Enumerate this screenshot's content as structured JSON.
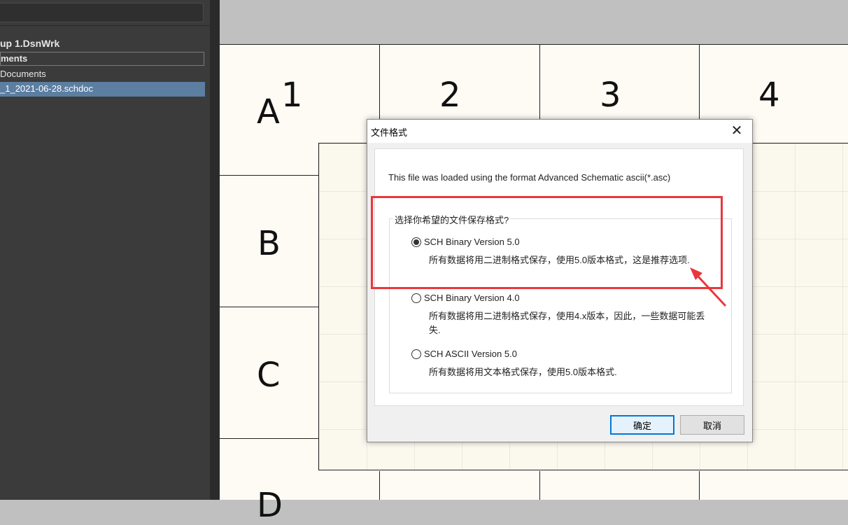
{
  "project_panel": {
    "workspace": "up 1.DsnWrk",
    "section": "ments",
    "documents_folder": "Documents",
    "selected_file": "_1_2021-06-28.schdoc"
  },
  "sheet": {
    "columns": [
      "1",
      "2",
      "3",
      "4"
    ],
    "rows": [
      "A",
      "B",
      "C",
      "D"
    ]
  },
  "dialog": {
    "title": "文件格式",
    "close_glyph": "✕",
    "message": "This file was loaded using the format Advanced Schematic ascii(*.asc)",
    "group_label": "选择你希望的文件保存格式?",
    "options": [
      {
        "label": "SCH Binary Version 5.0",
        "description": "所有数据将用二进制格式保存，使用5.0版本格式，这是推荐选项.",
        "checked": true
      },
      {
        "label": "SCH Binary Version 4.0",
        "description": "所有数据将用二进制格式保存，使用4.x版本，因此，一些数据可能丢失.",
        "checked": false
      },
      {
        "label": "SCH ASCII Version 5.0",
        "description": "所有数据将用文本格式保存，使用5.0版本格式.",
        "checked": false
      }
    ],
    "ok_label": "确定",
    "cancel_label": "取消"
  },
  "annotation": {
    "color": "#e8383d"
  }
}
